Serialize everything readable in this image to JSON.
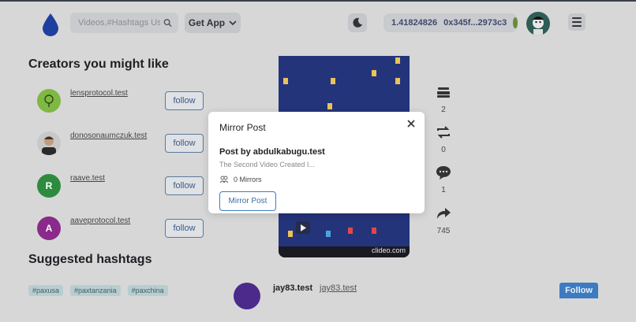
{
  "header": {
    "search_placeholder": "Videos,#Hashtags User",
    "get_app_label": "Get App",
    "wallet_balance": "1.41824826",
    "wallet_address": "0x345f...2973c3"
  },
  "creators_section": {
    "title": "Creators you might like",
    "creators": [
      {
        "name": "lensprotocol.test",
        "follow": "follow",
        "initial": "",
        "color": "#7fb842"
      },
      {
        "name": "donosonaumczuk.test",
        "follow": "follow",
        "initial": "",
        "color": "#b8b8b8"
      },
      {
        "name": "raave.test",
        "follow": "follow",
        "initial": "R",
        "color": "#2e8b3e"
      },
      {
        "name": "aaveprotocol.test",
        "follow": "follow",
        "initial": "A",
        "color": "#8a2a8a"
      }
    ]
  },
  "hashtags_section": {
    "title": "Suggested hashtags",
    "tags": [
      "#paxusa",
      "#paxtanzania",
      "#paxchina"
    ]
  },
  "suggested_user": {
    "name": "jay83.test",
    "handle": "jay83.test",
    "follow_label": "Follow"
  },
  "video": {
    "watermark": "clideo.com"
  },
  "stats": {
    "collects": "2",
    "mirrors": "0",
    "comments": "1",
    "shares": "745"
  },
  "modal": {
    "title": "Mirror Post",
    "post_by": "Post by abdulkabugu.test",
    "description": "The Second Video Created I...",
    "mirror_count": "0 Mirrors",
    "button_label": "Mirror Post"
  }
}
